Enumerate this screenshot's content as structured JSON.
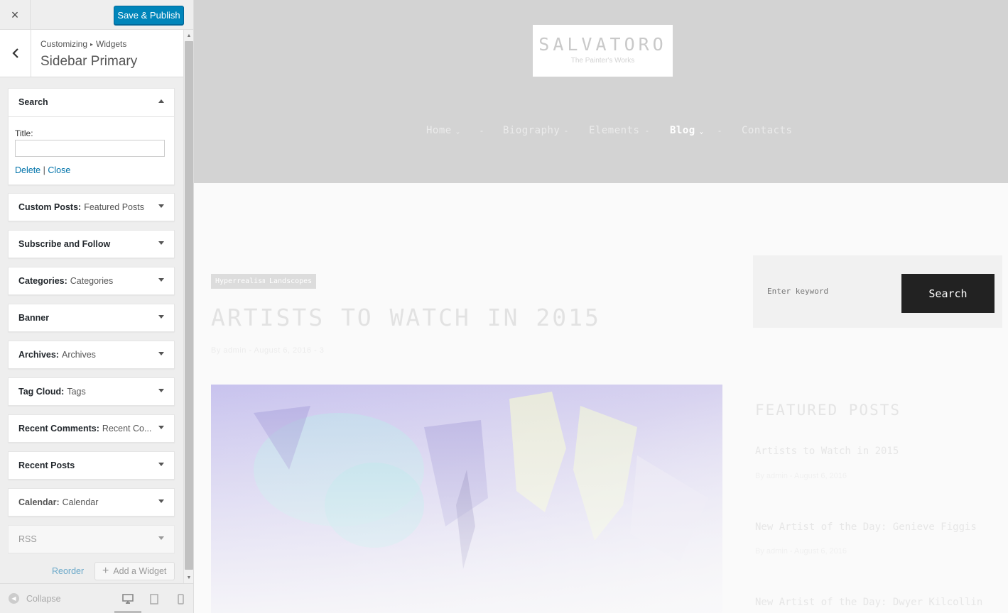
{
  "customizer": {
    "close_label": "×",
    "save_label": "Save & Publish",
    "breadcrumb": {
      "root": "Customizing",
      "separator": "▸",
      "current": "Widgets"
    },
    "section_title": "Sidebar Primary",
    "search_widget": {
      "title": "Search",
      "field_label": "Title:",
      "field_value": "",
      "delete_label": "Delete",
      "separator": "|",
      "close_label": "Close"
    },
    "widgets": [
      {
        "title": "Custom Posts:",
        "subtitle": "Featured Posts"
      },
      {
        "title": "Subscribe and Follow",
        "subtitle": ""
      },
      {
        "title": "Categories:",
        "subtitle": "Categories"
      },
      {
        "title": "Banner",
        "subtitle": ""
      },
      {
        "title": "Archives:",
        "subtitle": "Archives"
      },
      {
        "title": "Tag Cloud:",
        "subtitle": "Tags"
      },
      {
        "title": "Recent Comments:",
        "subtitle": "Recent Co..."
      },
      {
        "title": "Recent Posts",
        "subtitle": ""
      },
      {
        "title": "Calendar:",
        "subtitle": "Calendar"
      },
      {
        "title": "RSS",
        "subtitle": ""
      }
    ],
    "reorder_label": "Reorder",
    "add_widget_label": "Add a Widget",
    "collapse_label": "Collapse"
  },
  "preview": {
    "logo": {
      "name": "SALVATORO",
      "tagline": "The Painter's Works"
    },
    "nav": {
      "items": [
        "Home",
        "Biography",
        "Elements",
        "Blog",
        "Contacts"
      ],
      "active": "Blog",
      "separator": "-"
    },
    "post": {
      "tags": [
        "Hyperrealism",
        "Landscopes"
      ],
      "title": "ARTISTS TO WATCH IN 2015",
      "meta": "By admin - August 6, 2016 - 3"
    },
    "search": {
      "placeholder": "Enter keyword",
      "button_label": "Search"
    },
    "featured": {
      "heading": "FEATURED POSTS",
      "posts": [
        {
          "title": "Artists to Watch in 2015",
          "meta": "By admin - August 6, 2016"
        },
        {
          "title": "New Artist of the Day: Genieve Figgis",
          "meta": "By admin - August 6, 2016"
        },
        {
          "title": "New Artist of the Day: Dwyer Kilcollin",
          "meta": ""
        }
      ]
    }
  },
  "colors": {
    "primary_button": "#0085ba",
    "link": "#0073aa",
    "header_bg": "#d3d3d3",
    "search_button_bg": "#222222"
  }
}
